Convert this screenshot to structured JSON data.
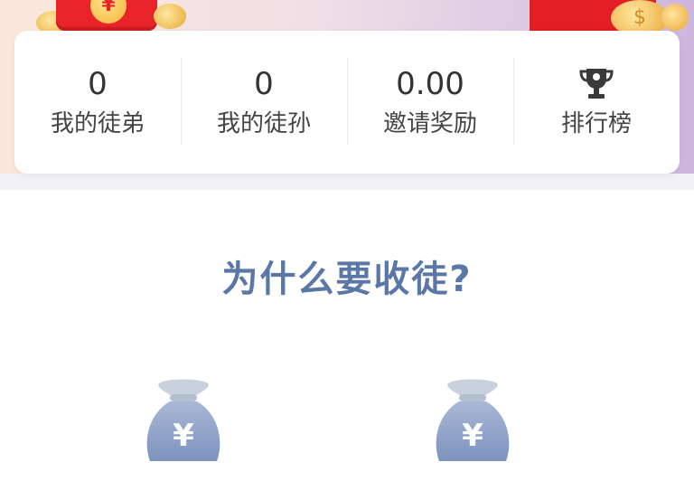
{
  "stats": [
    {
      "value": "0",
      "label": "我的徒弟"
    },
    {
      "value": "0",
      "label": "我的徒孙"
    },
    {
      "value": "0.00",
      "label": "邀请奖励"
    },
    {
      "icon": "trophy-icon",
      "label": "排行榜"
    }
  ],
  "section": {
    "title": "为什么要收徒?"
  },
  "bags": [
    {
      "icon": "money-bag-icon",
      "symbol": "¥"
    },
    {
      "icon": "money-bag-icon",
      "symbol": "¥"
    }
  ],
  "banner": {
    "left_coin_symbol": "¥",
    "right_coin_symbol": "$"
  },
  "colors": {
    "title": "#5a77a8",
    "bag": "#8da0c6",
    "red": "#e8232a"
  }
}
